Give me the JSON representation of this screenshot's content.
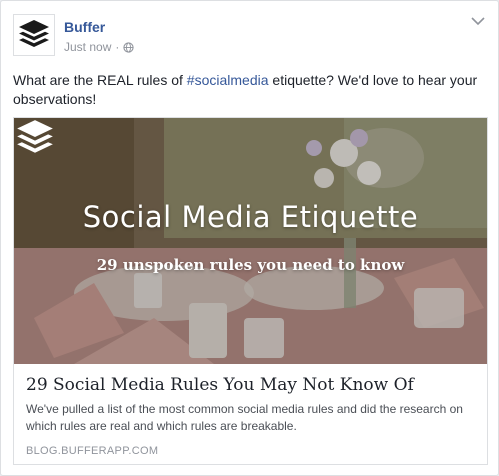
{
  "post": {
    "author": "Buffer",
    "timestamp": "Just now",
    "separator": "·",
    "audience_icon": "globe-icon",
    "text_before": "What are the REAL rules of ",
    "hashtag": "#socialmedia",
    "text_after": " etiquette? We'd love to hear your observations!"
  },
  "link_preview": {
    "image_title": "Social Media Etiquette",
    "image_subtitle": "29 unspoken rules you need to know",
    "title": "29 Social Media Rules You May Not Know Of",
    "description": "We've pulled a list of the most common social media rules and did the research on which rules are real and which rules are breakable.",
    "domain": "BLOG.BUFFERAPP.COM"
  },
  "colors": {
    "link_blue": "#365899",
    "meta_gray": "#90949c",
    "text": "#1d2129"
  }
}
